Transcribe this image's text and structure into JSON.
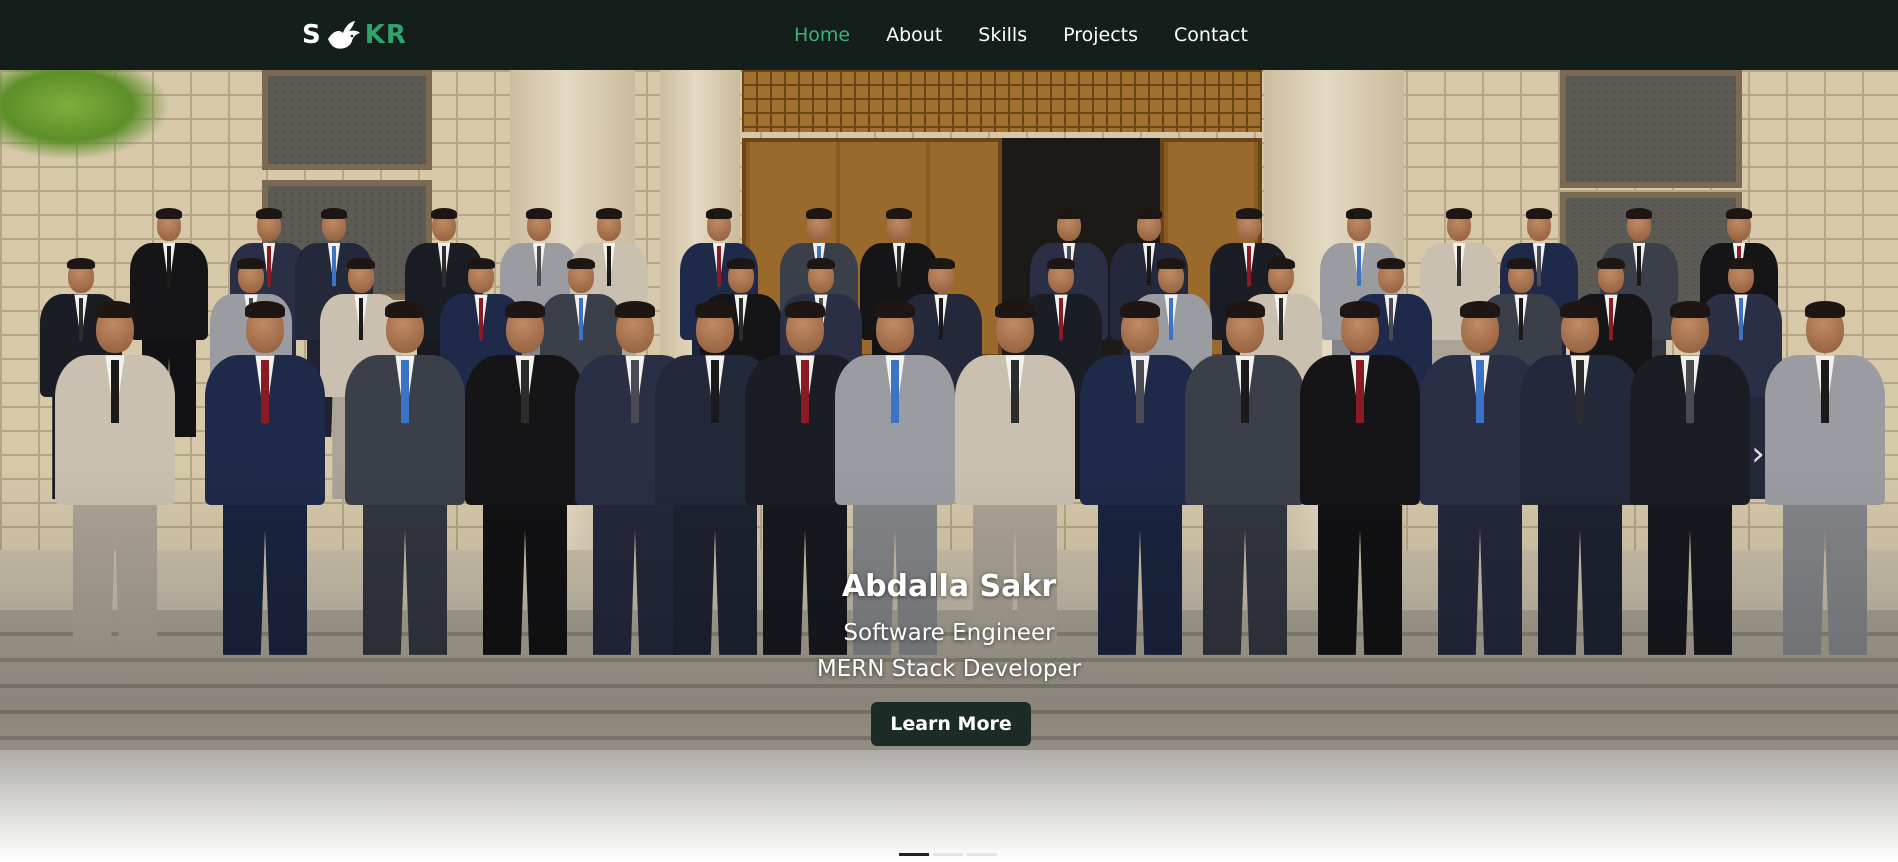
{
  "navbar": {
    "logo_left": "S",
    "logo_right": "KR",
    "links": [
      {
        "label": "Home",
        "active": true
      },
      {
        "label": "About",
        "active": false
      },
      {
        "label": "Skills",
        "active": false
      },
      {
        "label": "Projects",
        "active": false
      },
      {
        "label": "Contact",
        "active": false
      }
    ]
  },
  "hero": {
    "name": "Abdalla Sakr",
    "subtitle_1": "Software Engineer",
    "subtitle_2": "MERN Stack Developer",
    "cta_label": "Learn More",
    "next_arrow": "›",
    "slides": [
      {
        "active": true
      },
      {
        "active": false
      },
      {
        "active": false
      }
    ]
  },
  "colors": {
    "navbar_bg": "#141e1b",
    "accent": "#3bb273",
    "cta_bg": "#1d2b26"
  },
  "icons": {
    "logo_mark": "dove-icon",
    "carousel_next": "chevron-right-icon"
  }
}
